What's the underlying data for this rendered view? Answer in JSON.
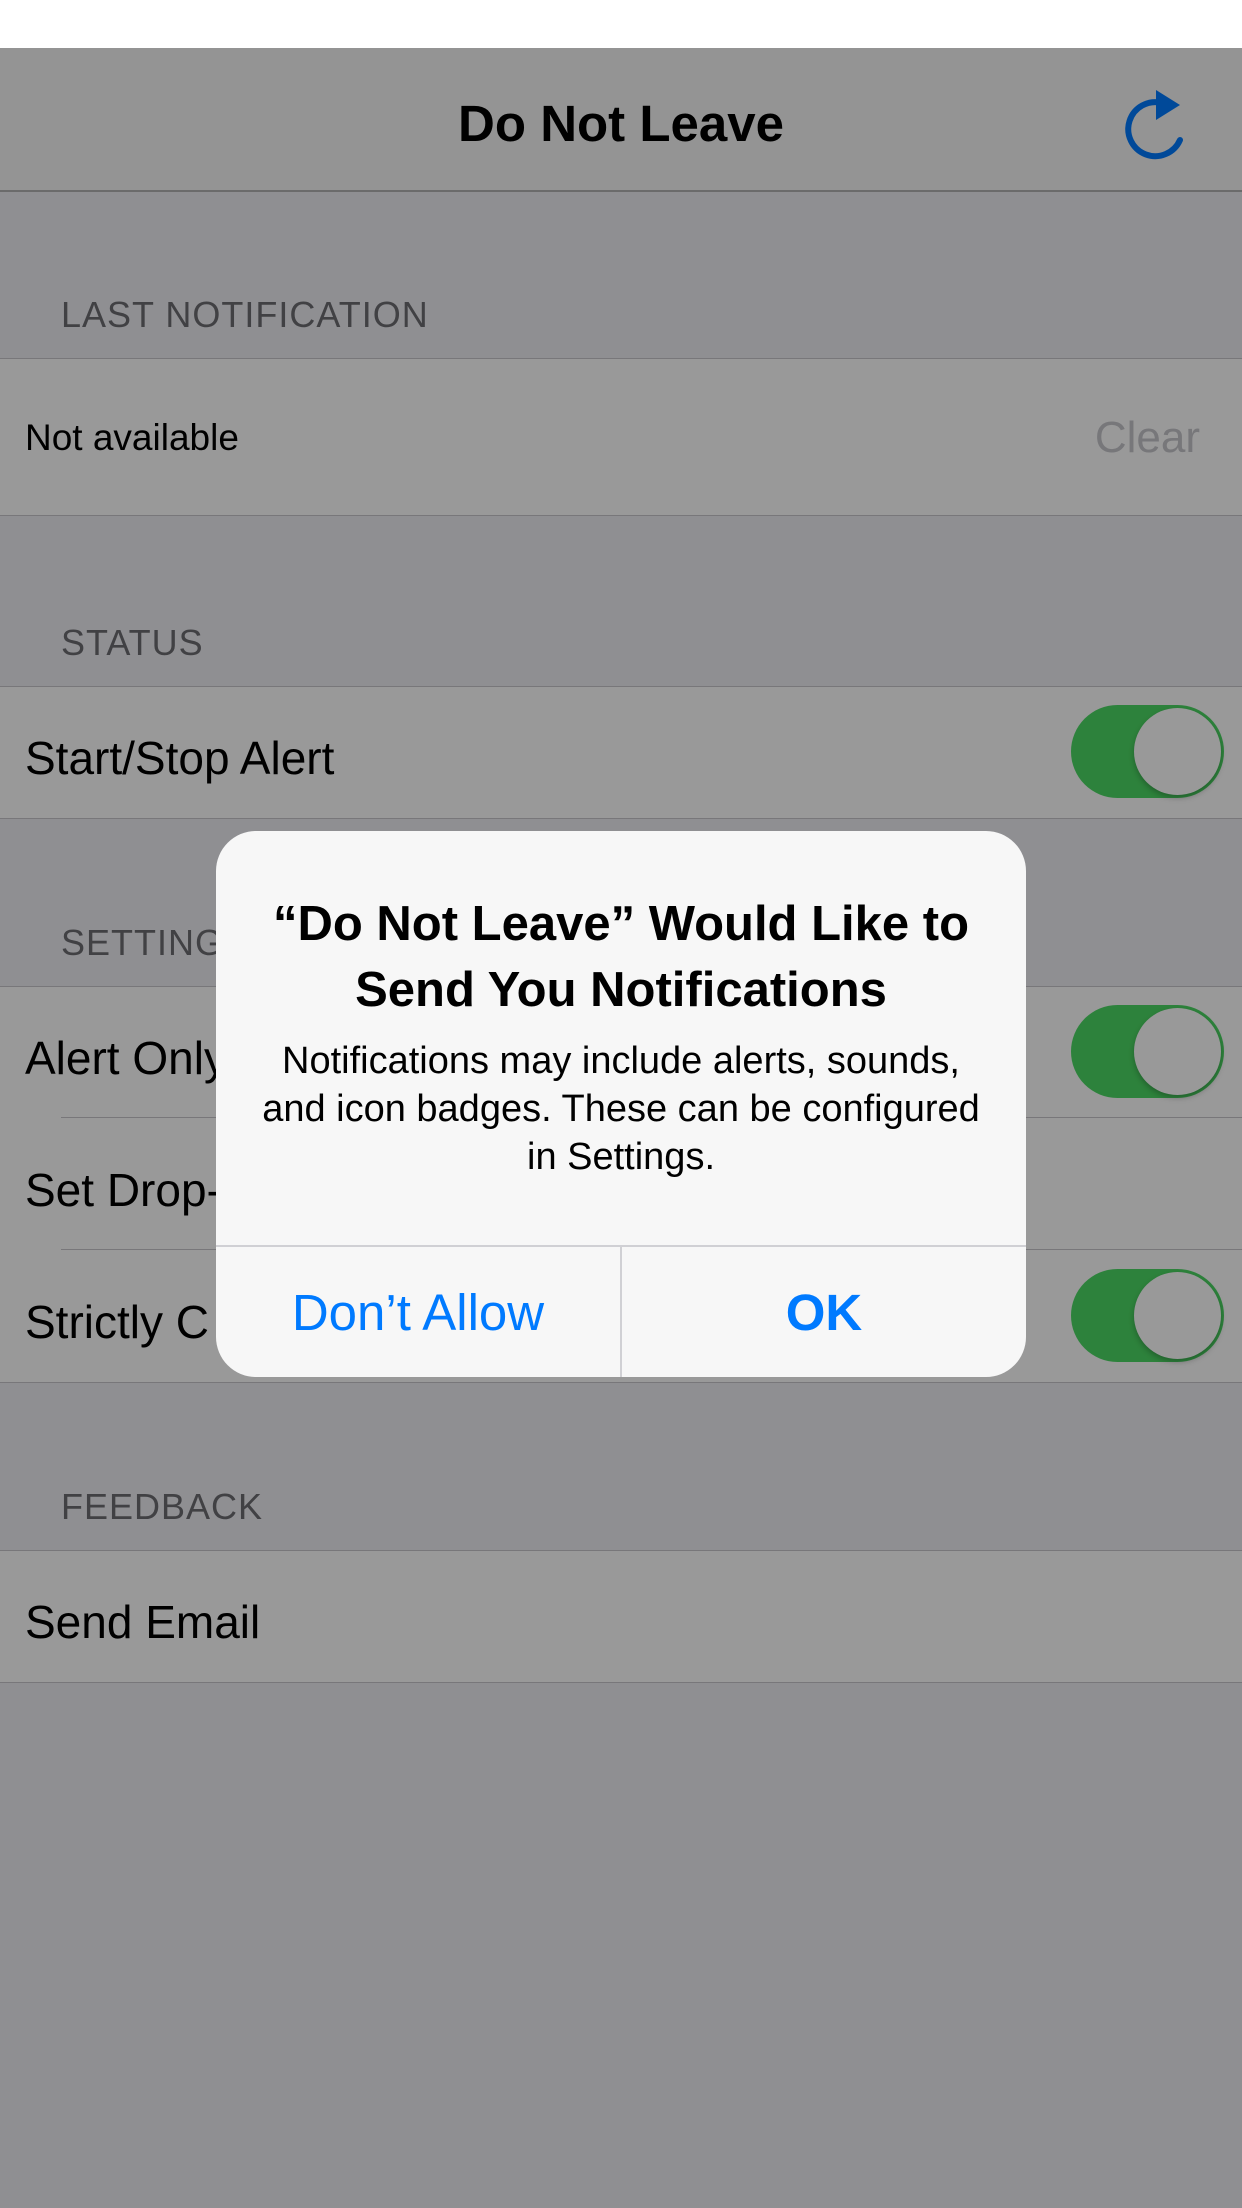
{
  "nav": {
    "title": "Do Not Leave"
  },
  "sections": {
    "last_notification": {
      "header": "LAST NOTIFICATION",
      "value": "Not available",
      "clear_label": "Clear"
    },
    "status": {
      "header": "STATUS",
      "start_stop_label": "Start/Stop Alert",
      "start_stop_on": true
    },
    "settings": {
      "header": "SETTINGS",
      "rows": [
        {
          "label": "Alert Only",
          "toggle_on": true
        },
        {
          "label": "Set Drop-"
        },
        {
          "label": "Strictly C",
          "toggle_on": true
        }
      ]
    },
    "feedback": {
      "header": "FEEDBACK",
      "send_email_label": "Send Email"
    }
  },
  "alert": {
    "title": "“Do Not Leave” Would Like to Send You Notifications",
    "message": "Notifications may include alerts, sounds, and icon badges. These can be configured in Settings.",
    "deny_label": "Don’t Allow",
    "ok_label": "OK"
  },
  "colors": {
    "accent": "#007aff",
    "toggle_on": "#4cd964",
    "background": "#efeff4"
  }
}
